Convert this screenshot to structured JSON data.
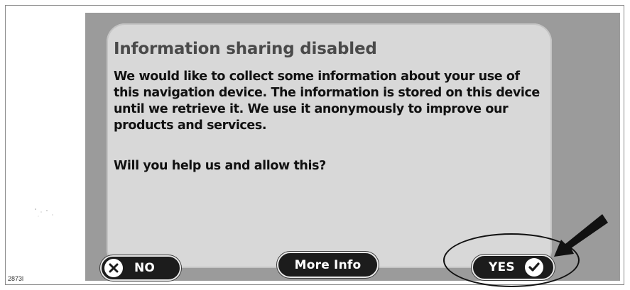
{
  "figure": {
    "code": "2873l"
  },
  "dialog": {
    "title": "Information sharing disabled",
    "message": "We would like to collect some information about your use of this navigation device. The information is stored on this device until we retrieve it. We use it anonymously to improve our products and services.",
    "question": "Will you help us and allow this?"
  },
  "buttons": {
    "no": {
      "label": "NO",
      "icon": "x-circle-icon"
    },
    "more_info": {
      "label": "More Info"
    },
    "yes": {
      "label": "YES",
      "icon": "checkmark-circle-icon"
    }
  },
  "annotation": {
    "highlighted_button": "yes",
    "arrow_icon": "pointer-arrow-icon"
  },
  "colors": {
    "screen_border": "#9b9b9b",
    "panel_background": "#d8d8d8",
    "button_background": "#1c1c1c",
    "button_text": "#ffffff",
    "title_text": "#4a4a4a",
    "body_text": "#111111"
  }
}
